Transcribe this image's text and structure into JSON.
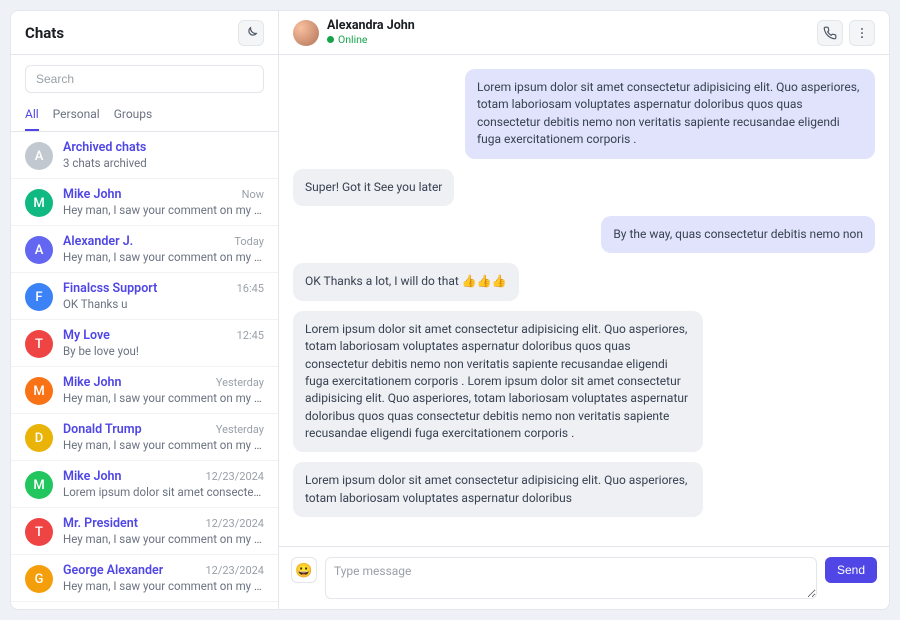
{
  "sidebar": {
    "title": "Chats",
    "search_placeholder": "Search",
    "tabs": [
      "All",
      "Personal",
      "Groups"
    ],
    "active_tab": 0,
    "chats": [
      {
        "name": "Archived chats",
        "preview": "3 chats archived",
        "time": "",
        "initial": "A",
        "color": "#c2c8d0"
      },
      {
        "name": "Mike John",
        "preview": "Hey man, I saw your comment on my Figma p...",
        "time": "Now",
        "initial": "M",
        "color": "#10b981"
      },
      {
        "name": "Alexander J.",
        "preview": "Hey man, I saw your comment on my Figma p...",
        "time": "Today",
        "initial": "A",
        "color": "#6366f1"
      },
      {
        "name": "Finalcss Support",
        "preview": "OK Thanks u",
        "time": "16:45",
        "initial": "F",
        "color": "#3b82f6"
      },
      {
        "name": "My Love",
        "preview": "By be love you!",
        "time": "12:45",
        "initial": "T",
        "color": "#ef4444"
      },
      {
        "name": "Mike John",
        "preview": "Hey man, I saw your comment on my Figma p...",
        "time": "Yesterday",
        "initial": "M",
        "color": "#f97316"
      },
      {
        "name": "Donald Trump",
        "preview": "Hey man, I saw your comment on my Figma p...",
        "time": "Yesterday",
        "initial": "D",
        "color": "#eab308"
      },
      {
        "name": "Mike John",
        "preview": "Lorem ipsum dolor sit amet consectetur adipi...",
        "time": "12/23/2024",
        "initial": "M",
        "color": "#22c55e"
      },
      {
        "name": "Mr. President",
        "preview": "Hey man, I saw your comment on my Figma p...",
        "time": "12/23/2024",
        "initial": "T",
        "color": "#ef4444"
      },
      {
        "name": "George Alexander",
        "preview": "Hey man, I saw your comment on my Figma p...",
        "time": "12/23/2024",
        "initial": "G",
        "color": "#f59e0b"
      }
    ]
  },
  "conversation": {
    "contact_name": "Alexandra John",
    "status": "Online",
    "messages": [
      {
        "dir": "out",
        "text": "Lorem ipsum dolor sit amet consectetur adipisicing elit. Quo asperiores, totam laboriosam voluptates aspernatur doloribus quos quas consectetur debitis nemo non veritatis sapiente recusandae eligendi fuga exercitationem corporis ."
      },
      {
        "dir": "in",
        "text": "Super! Got it See you later"
      },
      {
        "dir": "out",
        "text": "By the way, quas consectetur debitis nemo non"
      },
      {
        "dir": "in",
        "text": "OK Thanks a lot, I will do that 👍👍👍"
      },
      {
        "dir": "in",
        "text": "Lorem ipsum dolor sit amet consectetur adipisicing elit. Quo asperiores, totam laboriosam voluptates aspernatur doloribus quos quas consectetur debitis nemo non veritatis sapiente recusandae eligendi fuga exercitationem corporis . Lorem ipsum dolor sit amet consectetur adipisicing elit. Quo asperiores, totam laboriosam voluptates aspernatur doloribus quos quas consectetur debitis nemo non veritatis sapiente recusandae eligendi fuga exercitationem corporis ."
      },
      {
        "dir": "in",
        "text": "Lorem ipsum dolor sit amet consectetur adipisicing elit. Quo asperiores, totam laboriosam voluptates aspernatur doloribus"
      }
    ],
    "compose_placeholder": "Type message",
    "emoji": "😀",
    "send_label": "Send"
  }
}
